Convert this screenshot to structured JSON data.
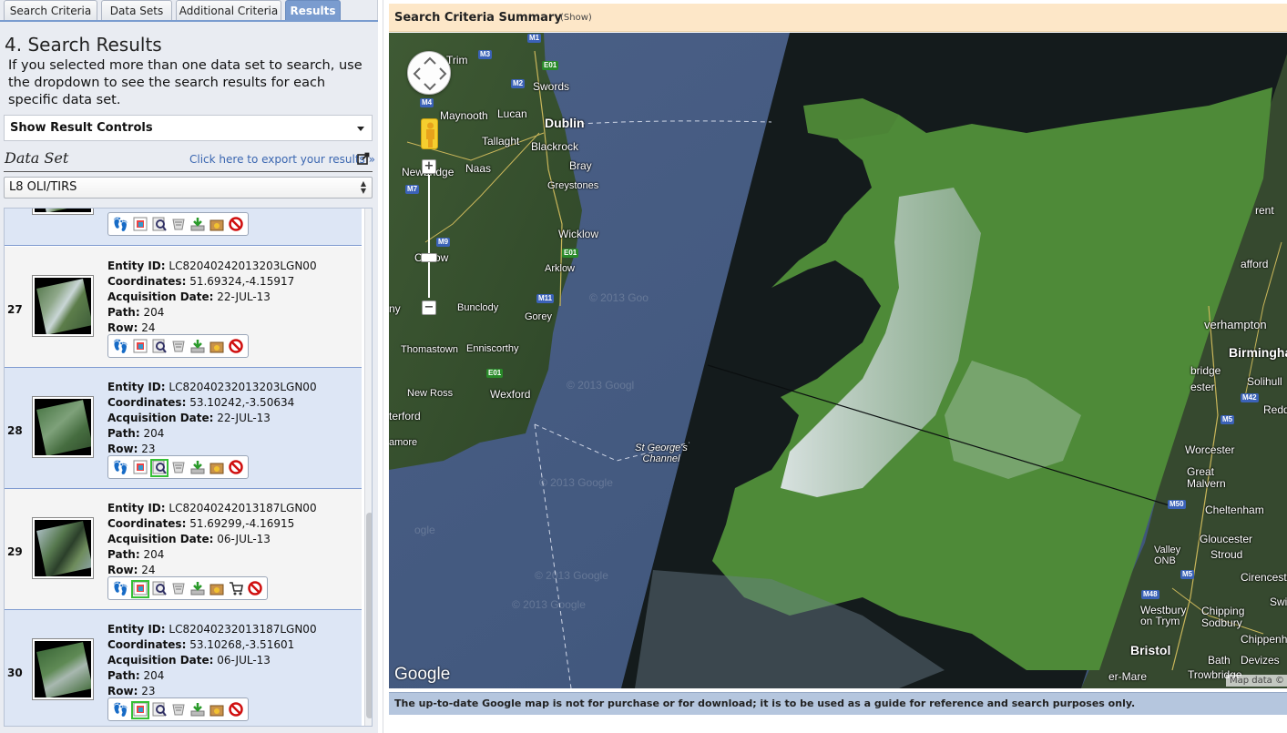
{
  "tabs": [
    {
      "label": "Search Criteria",
      "active": false
    },
    {
      "label": "Data Sets",
      "active": false
    },
    {
      "label": "Additional Criteria",
      "active": false
    },
    {
      "label": "Results",
      "active": true
    }
  ],
  "panel": {
    "heading": "4. Search Results",
    "instructions": "If you selected more than one data set to search, use the dropdown to see the search results for each specific data set.",
    "result_controls_label": "Show Result Controls",
    "dataset_label": "Data Set",
    "export_link": "Click here to export your results »",
    "dataset_selected": "L8 OLI/TIRS"
  },
  "field_labels": {
    "entity_id": "Entity ID:",
    "coordinates": "Coordinates:",
    "acquisition_date": "Acquisition Date:",
    "path": "Path:",
    "row": "Row:"
  },
  "results": [
    {
      "number": "27",
      "entity_id": "LC82040242013203LGN00",
      "coordinates": "51.69324,-4.15917",
      "acquisition_date": "22-JUL-13",
      "path": "204",
      "row": "24",
      "selected_tool": null,
      "has_cart": false
    },
    {
      "number": "28",
      "entity_id": "LC82040232013203LGN00",
      "coordinates": "53.10242,-3.50634",
      "acquisition_date": "22-JUL-13",
      "path": "204",
      "row": "23",
      "selected_tool": "metadata",
      "has_cart": false
    },
    {
      "number": "29",
      "entity_id": "LC82040242013187LGN00",
      "coordinates": "51.69299,-4.16915",
      "acquisition_date": "06-JUL-13",
      "path": "204",
      "row": "24",
      "selected_tool": "overlay",
      "has_cart": true
    },
    {
      "number": "30",
      "entity_id": "LC82040232013187LGN00",
      "coordinates": "53.10268,-3.51601",
      "acquisition_date": "06-JUL-13",
      "path": "204",
      "row": "23",
      "selected_tool": "overlay",
      "has_cart": false
    }
  ],
  "toolbar_icons": [
    "footprint-icon",
    "overlay-icon",
    "metadata-icon",
    "compare-icon",
    "download-icon",
    "order-scene-icon",
    "exclude-icon"
  ],
  "summary": {
    "title": "Search Criteria Summary",
    "show": "(Show)"
  },
  "map": {
    "labels": [
      {
        "text": "Dublin",
        "big": true
      },
      {
        "text": "Trim"
      },
      {
        "text": "Swords"
      },
      {
        "text": "Maynooth"
      },
      {
        "text": "Lucan"
      },
      {
        "text": "Tallaght"
      },
      {
        "text": "Blackrock"
      },
      {
        "text": "Bray"
      },
      {
        "text": "Naas"
      },
      {
        "text": "Newbridge"
      },
      {
        "text": "Greystones"
      },
      {
        "text": "Wicklow"
      },
      {
        "text": "Carlow"
      },
      {
        "text": "Arklow"
      },
      {
        "text": "Bunclody"
      },
      {
        "text": "Gorey"
      },
      {
        "text": "Thomastown"
      },
      {
        "text": "Enniscorthy"
      },
      {
        "text": "New Ross"
      },
      {
        "text": "Wexford"
      },
      {
        "text": "terford"
      },
      {
        "text": "amore"
      },
      {
        "text": "St George's Channel"
      },
      {
        "text": "rent"
      },
      {
        "text": "afford"
      },
      {
        "text": "verhampton"
      },
      {
        "text": "Birmingha"
      },
      {
        "text": "bridge"
      },
      {
        "text": "Solihull"
      },
      {
        "text": "ester"
      },
      {
        "text": "Redd"
      },
      {
        "text": "Worcester"
      },
      {
        "text": "Great Malvern"
      },
      {
        "text": "Cheltenham"
      },
      {
        "text": "Gloucester"
      },
      {
        "text": "Stroud"
      },
      {
        "text": "Valley ONB"
      },
      {
        "text": "Cirencester"
      },
      {
        "text": "Westbury on Trym"
      },
      {
        "text": "Chipping Sodbury"
      },
      {
        "text": "Chippenha"
      },
      {
        "text": "Bristol",
        "big": true
      },
      {
        "text": "Bath"
      },
      {
        "text": "Devizes"
      },
      {
        "text": "Trowbridge"
      },
      {
        "text": "er-Mare"
      },
      {
        "text": "Swin"
      },
      {
        "text": "ny"
      }
    ],
    "roads": [
      "M1",
      "M3",
      "E01",
      "M2",
      "M4",
      "M7",
      "M9",
      "M11",
      "E01",
      "E01",
      "M42",
      "M5",
      "M50",
      "M5",
      "M48"
    ],
    "watermarks": [
      "© 2013 Goo",
      "© 2013 Googl",
      "© 2013 Google",
      "© 2013 Google",
      "© 2013 Google",
      "ogle"
    ],
    "google_logo": "Google",
    "map_data": "Map data ©",
    "zoom_in": "+",
    "zoom_out": "−"
  },
  "disclaimer": "The up-to-date Google map is not for purchase or for download; it is to be used as a guide for reference and search purposes only."
}
